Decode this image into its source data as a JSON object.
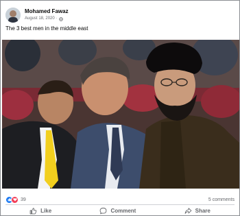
{
  "post": {
    "author": "Mohamed Fawaz",
    "date": "August 18, 2020",
    "separator": "·",
    "privacy_icon": "globe-icon",
    "caption": "The 3 best men in the middle east",
    "photo_icon": "photo-of-three-seated-men"
  },
  "stats": {
    "reaction_icons": [
      "like-reaction-icon",
      "love-reaction-icon"
    ],
    "reaction_count": "39",
    "comments": "5 comments"
  },
  "actions": {
    "like": "Like",
    "comment": "Comment",
    "share": "Share"
  },
  "colors": {
    "like_blue": "#1877f2",
    "love_red": "#f33e58",
    "secondary_text": "#65676b",
    "primary_text": "#050505"
  }
}
